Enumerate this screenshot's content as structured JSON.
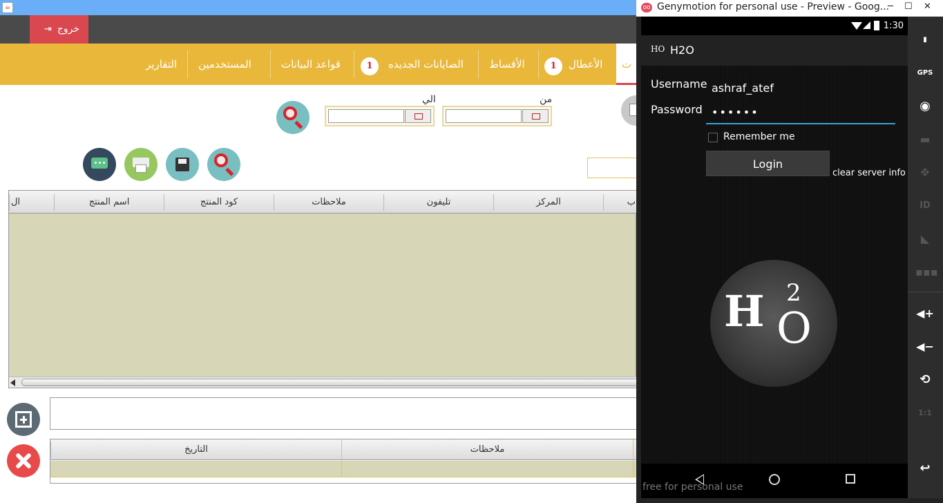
{
  "java_window": {
    "logout": {
      "label": "خروج"
    },
    "nav": {
      "active_partial": "ت",
      "items": [
        {
          "label": "الأعطال",
          "badge": "1"
        },
        {
          "label": "الأقساط"
        },
        {
          "label": "الصايانات الجديده",
          "badge": "1"
        },
        {
          "label": "قواعد البيانات"
        },
        {
          "label": "المستخدمين"
        },
        {
          "label": "التقارير"
        }
      ]
    },
    "filters": {
      "from_label": "من",
      "to_label": "الي"
    },
    "main_table": {
      "columns": [
        "ال",
        "اسم المنتج",
        "كود المنتج",
        "ملاحظات",
        "تليفون",
        "المركز",
        "ب"
      ]
    },
    "bottom_table": {
      "columns": [
        "التاريخ",
        "ملاحظات"
      ]
    }
  },
  "genymotion": {
    "window_title": "Genymotion for personal use - Preview - Goog...",
    "status_time": "1:30",
    "app_logo": "HO",
    "app_title": "H2O",
    "username_label": "Username",
    "username_value": "ashraf_atef",
    "password_label": "Password",
    "password_value": "••••••",
    "remember_label": "Remember me",
    "login_label": "Login",
    "clear_info_label": "clear server info",
    "logo_text": {
      "h": "H",
      "sup": "2",
      "o": "O"
    },
    "watermark": "free for personal use",
    "side_icons": [
      "battery",
      "GPS",
      "webcam",
      "clapper",
      "dpad",
      "ID",
      "rss",
      "sms",
      "volume-up",
      "volume-down",
      "rotate",
      "1:1"
    ]
  }
}
